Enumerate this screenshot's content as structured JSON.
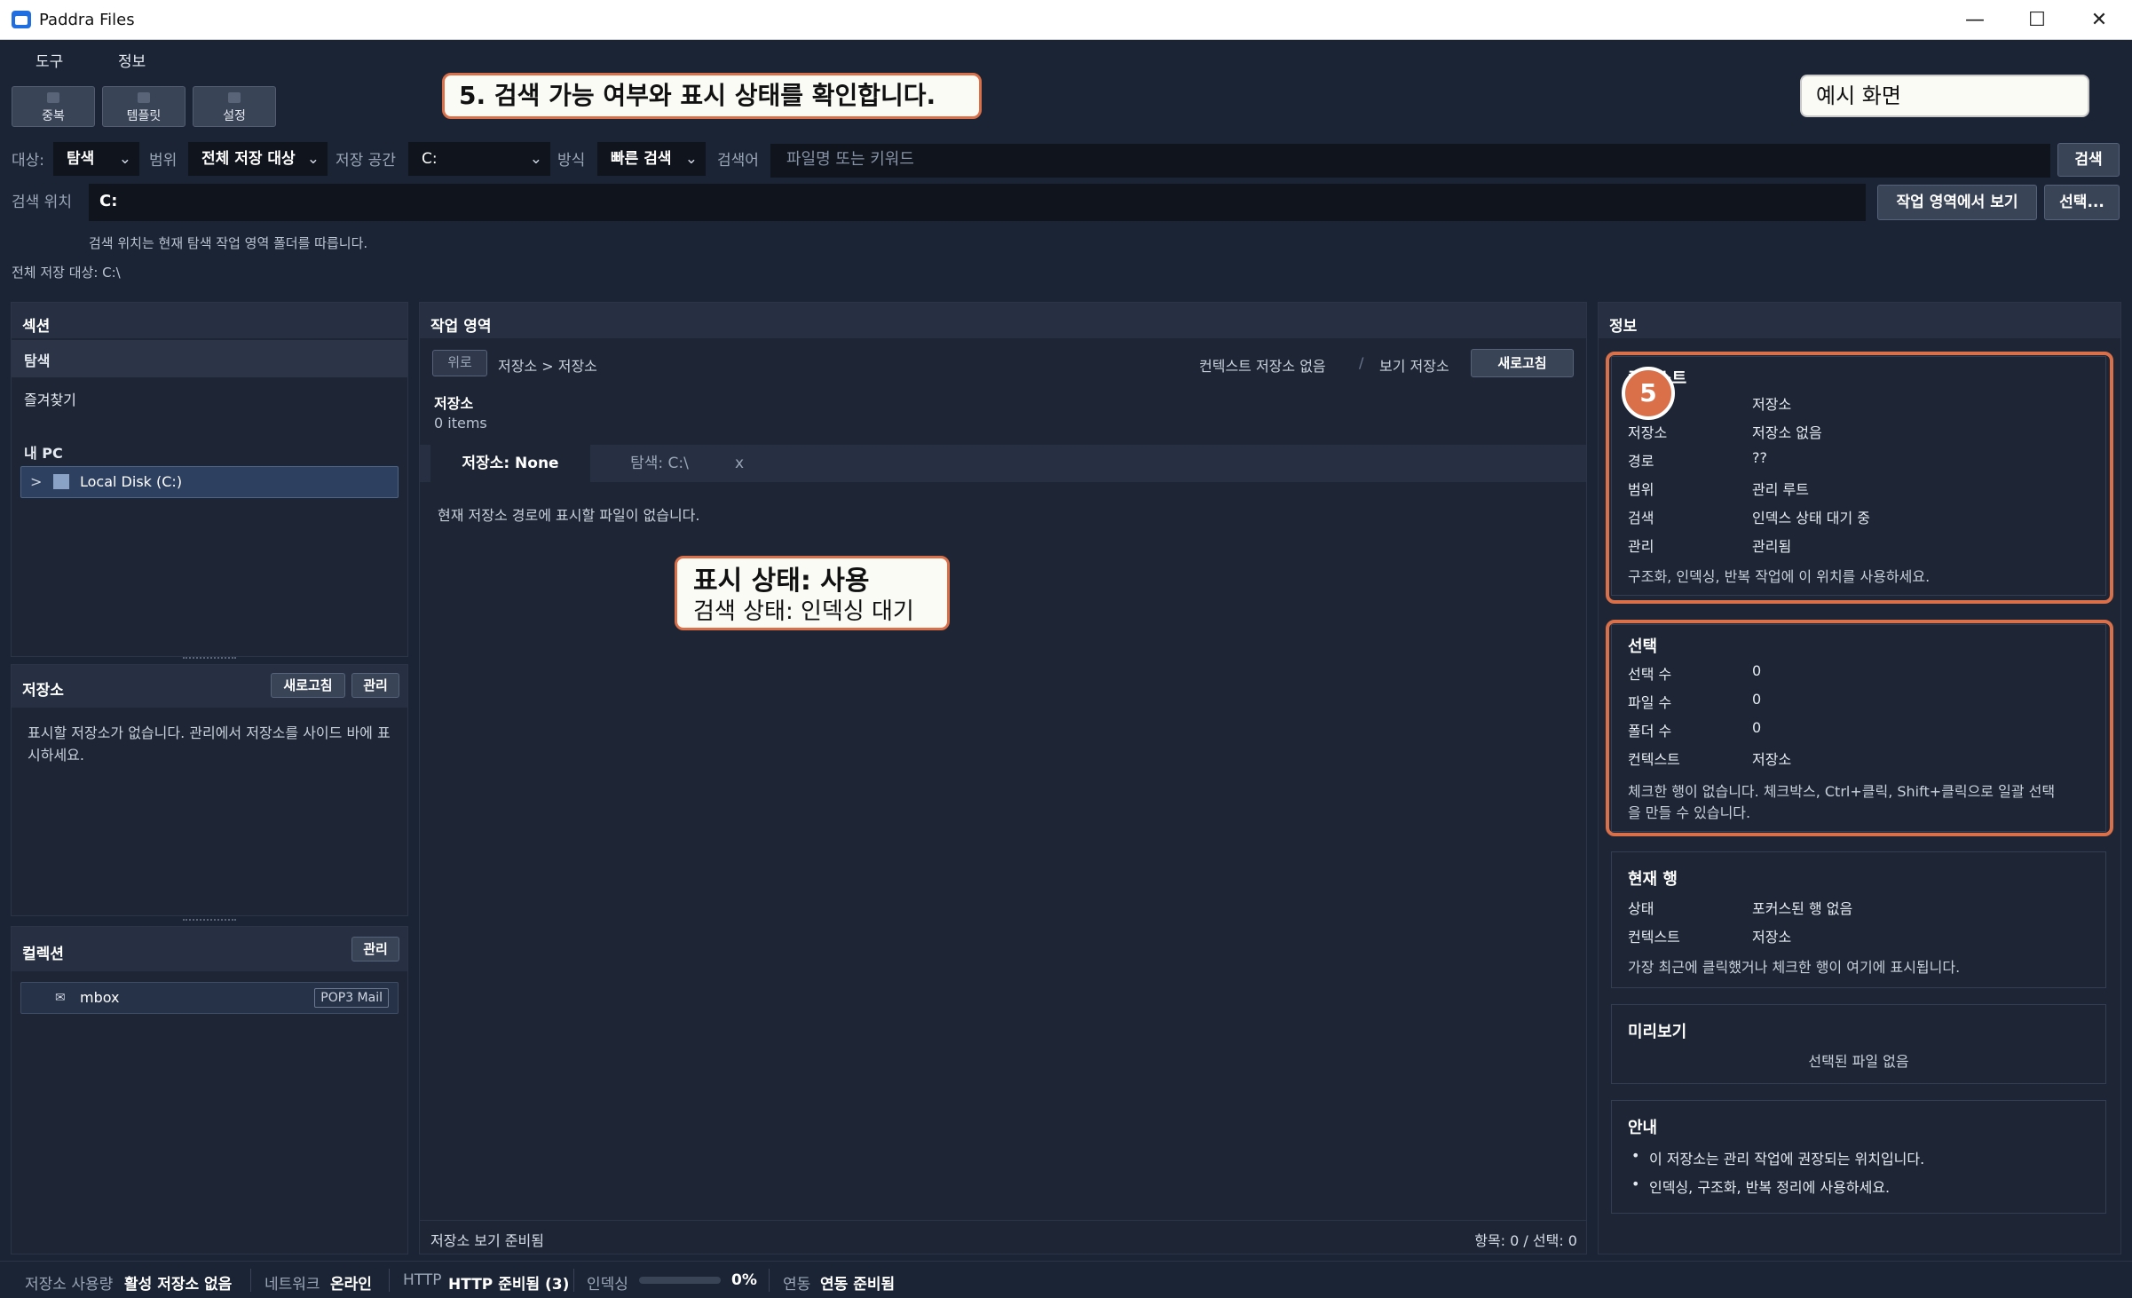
{
  "window": {
    "title": "Paddra Files",
    "minimize": "—",
    "maximize": "☐",
    "close": "✕"
  },
  "menu": [
    "도구",
    "정보"
  ],
  "toolbar": {
    "duplicate": "중복",
    "template": "템플릿",
    "settings": "설정"
  },
  "callouts": {
    "step": "5. 검색 가능 여부와 표시 상태를 확인합니다.",
    "example": "예시 화면",
    "badge": "5",
    "display_state": "표시 상태: 사용",
    "search_state": "검색 상태: 인덱싱 대기"
  },
  "search_row": {
    "target_label": "대상:",
    "target_value": "탐색",
    "scope_label": "범위",
    "scope_value": "전체 저장 대상",
    "storage_label": "저장 공간",
    "storage_value": "C:",
    "method_label": "방식",
    "method_value": "빠른 검색",
    "query_label": "검색어",
    "query_placeholder": "파일명 또는 키워드",
    "search_button": "검색"
  },
  "location_row": {
    "label": "검색 위치",
    "value": "C:",
    "view_button": "작업 영역에서 보기",
    "choose_button": "선택...",
    "hint": "검색 위치는 현재 탐색 작업 영역 폴더를 따릅니다.",
    "all_targets": "전체 저장 대상: C:\\"
  },
  "sections": {
    "title": "섹션",
    "items": [
      "탐색",
      "즐겨찾기"
    ],
    "mypc": "내 PC",
    "disk": "Local Disk (C:)",
    "disk_toggle": ">"
  },
  "storage_panel": {
    "title": "저장소",
    "refresh": "새로고침",
    "manage": "관리",
    "empty": "표시할 저장소가 없습니다. 관리에서 저장소를 사이드 바에 표시하세요."
  },
  "collection_panel": {
    "title": "컬렉션",
    "manage": "관리",
    "item": "mbox",
    "badge": "POP3 Mail"
  },
  "workspace": {
    "title": "작업 영역",
    "up": "위로",
    "breadcrumb": "저장소 > 저장소",
    "context": "컨텍스트 저장소 없음",
    "slash": "/",
    "view": "보기 저장소",
    "refresh": "새로고침",
    "folder_name": "저장소",
    "count": "0 items",
    "tabs": [
      "저장소: None",
      "탐색: C:\\",
      "x"
    ],
    "empty": "현재 저장소 경로에 표시할 파일이 없습니다.",
    "status_left": "저장소 보기 준비됨",
    "status_right": "항목: 0 / 선택: 0"
  },
  "info": {
    "title": "정보",
    "context": {
      "heading": "컨텍스트",
      "rows": [
        {
          "k": "",
          "v": "저장소"
        },
        {
          "k": "저장소",
          "v": "저장소 없음"
        },
        {
          "k": "경로",
          "v": "??"
        },
        {
          "k": "범위",
          "v": "관리 루트"
        },
        {
          "k": "검색",
          "v": "인덱스 상태 대기 중"
        },
        {
          "k": "관리",
          "v": "관리됨"
        }
      ],
      "note": "구조화, 인덱싱, 반복 작업에 이 위치를 사용하세요."
    },
    "selection": {
      "heading": "선택",
      "rows": [
        {
          "k": "선택 수",
          "v": "0"
        },
        {
          "k": "파일 수",
          "v": "0"
        },
        {
          "k": "폴더 수",
          "v": "0"
        },
        {
          "k": "컨텍스트",
          "v": "저장소"
        }
      ],
      "note1": "체크한 행이 없습니다. 체크박스, Ctrl+클릭, Shift+클릭으로 일괄 선택",
      "note2": "을 만들 수 있습니다."
    },
    "current_row": {
      "heading": "현재 행",
      "rows": [
        {
          "k": "상태",
          "v": "포커스된 행 없음"
        },
        {
          "k": "컨텍스트",
          "v": "저장소"
        }
      ],
      "note": "가장 최근에 클릭했거나 체크한 행이 여기에 표시됩니다."
    },
    "preview": {
      "heading": "미리보기",
      "empty": "선택된 파일 없음"
    },
    "guide": {
      "heading": "안내",
      "items": [
        "이 저장소는 관리 작업에 권장되는 위치입니다.",
        "인덱싱, 구조화, 반복 정리에 사용하세요."
      ]
    }
  },
  "statusbar": {
    "usage_label": "저장소 사용량",
    "usage_value": "활성 저장소 없음",
    "network_label": "네트워크",
    "network_value": "온라인",
    "http_label": "HTTP",
    "http_value": "HTTP 준비됨 (3)",
    "index_label": "인덱싱",
    "index_value": "0%",
    "index_progress": 0,
    "sync_label": "연동",
    "sync_value": "연동 준비됨"
  }
}
